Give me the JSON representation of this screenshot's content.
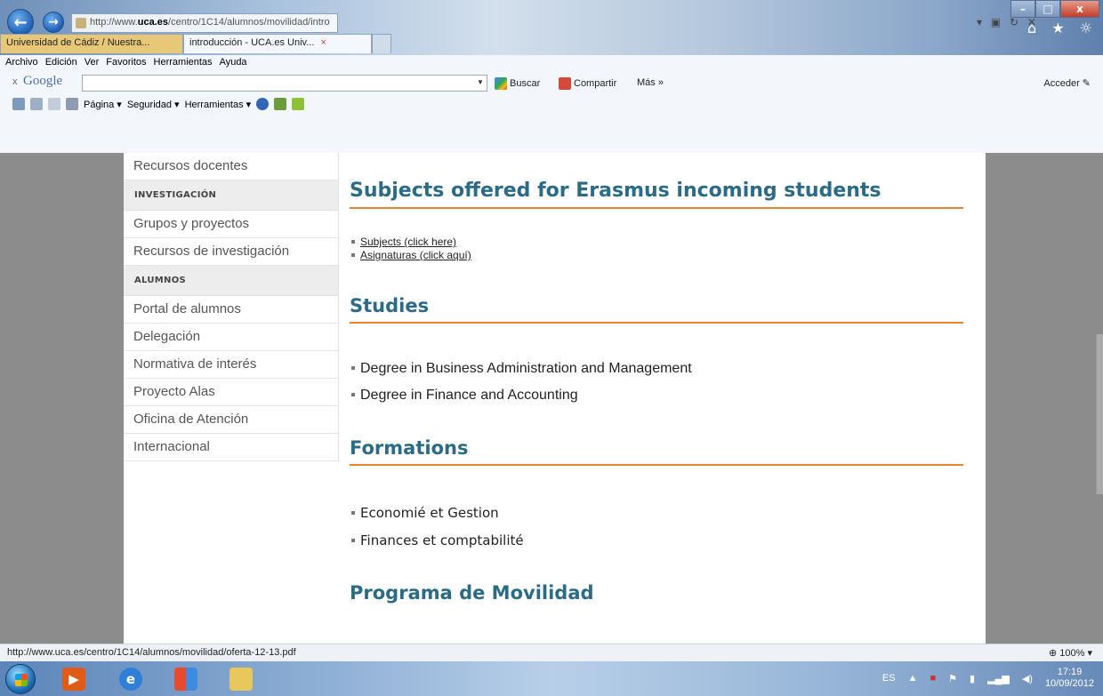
{
  "browser": {
    "url_prefix": "http://www.",
    "url_domain": "uca.es",
    "url_path": "/centro/1C14/alumnos/movilidad/intro",
    "address_right_icons": "▾ ▣ ↻ ✕",
    "window_controls": {
      "minimize": "–",
      "maximize": "□",
      "close": "x"
    },
    "toolbar_icons": "⌂ ★ ☼",
    "tabs": [
      {
        "label": "Universidad de Cádiz / Nuestra..."
      },
      {
        "label": "introducción - UCA.es Univ...",
        "close": "×"
      }
    ],
    "menu": [
      "Archivo",
      "Edición",
      "Ver",
      "Favoritos",
      "Herramientas",
      "Ayuda"
    ],
    "google_bar": {
      "close": "x",
      "logo": "Google",
      "dropdown": "▼",
      "search_label": "Buscar",
      "share_label": "Compartir",
      "more_label": "Más »",
      "signin_label": "Acceder"
    },
    "command_bar": {
      "pagina": "Página ▾",
      "seguridad": "Seguridad ▾",
      "herramientas": "Herramientas ▾"
    }
  },
  "sidebar": {
    "items_top": [
      {
        "label": "Recursos docentes"
      }
    ],
    "section1": "INVESTIGACIÓN",
    "items_inv": [
      {
        "label": "Grupos y proyectos"
      },
      {
        "label": "Recursos de investigación"
      }
    ],
    "section2": "ALUMNOS",
    "items_alu": [
      {
        "label": "Portal de alumnos"
      },
      {
        "label": "Delegación"
      },
      {
        "label": "Normativa de interés"
      },
      {
        "label": "Proyecto Alas"
      },
      {
        "label": "Oficina de Atención"
      },
      {
        "label": "Internacional"
      }
    ]
  },
  "main": {
    "heading1": "Subjects offered for Erasmus incoming students",
    "subjects_link": "Subjects (click here)",
    "asignaturas_link": "Asignaturas (click aquí)",
    "heading2": "Studies",
    "studies": [
      "Degree in Business Administration and Management",
      "Degree in Finance and Accounting"
    ],
    "heading3": "Formations",
    "formations": [
      "Economié et Gestion",
      "Finances et comptabilité"
    ],
    "heading4": "Programa de Movilidad"
  },
  "status": {
    "url": "http://www.uca.es/centro/1C14/alumnos/movilidad/oferta-12-13.pdf",
    "zoom": "100%"
  },
  "taskbar": {
    "lang": "ES",
    "time": "17:19",
    "date": "10/09/2012"
  }
}
